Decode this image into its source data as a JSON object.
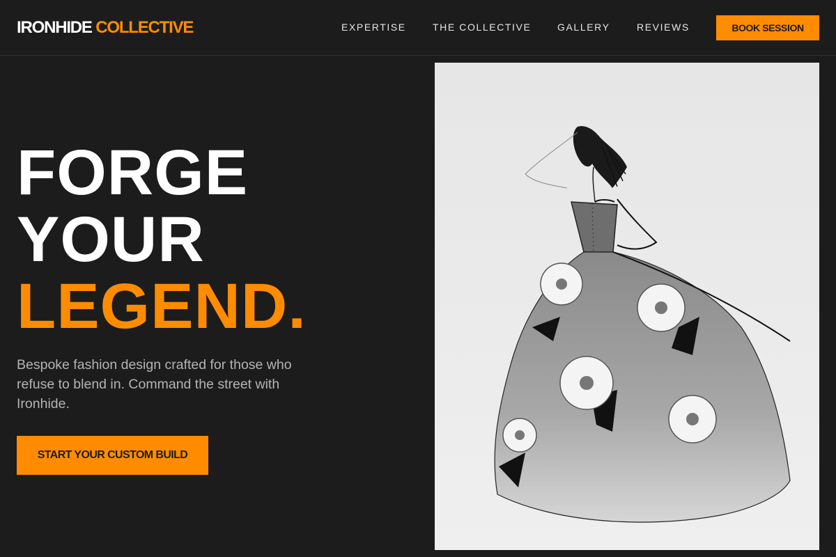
{
  "brand": {
    "name": "IRONHIDE",
    "accent": "COLLECTIVE"
  },
  "nav": {
    "items": [
      {
        "label": "EXPERTISE"
      },
      {
        "label": "THE COLLECTIVE"
      },
      {
        "label": "GALLERY"
      },
      {
        "label": "REVIEWS"
      }
    ],
    "cta": "BOOK SESSION"
  },
  "hero": {
    "headline_line1": "FORGE",
    "headline_line2": "YOUR",
    "headline_line3": "LEGEND.",
    "subtext": "Bespoke fashion design crafted for those who refuse to blend in. Command the street with Ironhide.",
    "cta": "START YOUR CUSTOM BUILD",
    "image": {
      "subject": "fashion sketch of a strapless ball gown with flower appliqués"
    }
  },
  "colors": {
    "background": "#1c1c1c",
    "accent": "#ff8c00",
    "text": "#ffffff",
    "muted_text": "#b4b4b4",
    "image_bg": "#ebebeb"
  }
}
